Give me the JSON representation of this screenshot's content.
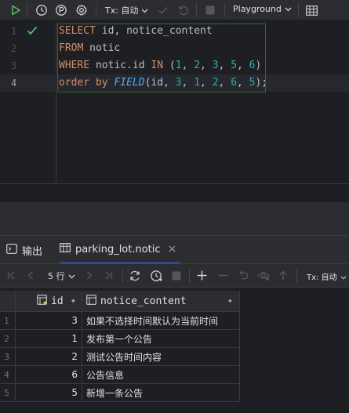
{
  "toolbar": {
    "tx_label": "Tx: 自动",
    "playground_label": "Playground",
    "accent_run": "#5fb865"
  },
  "editor": {
    "lines": [
      {
        "no": "1"
      },
      {
        "no": "2"
      },
      {
        "no": "3"
      },
      {
        "no": "4"
      }
    ],
    "line1": {
      "kw": "SELECT",
      "rest": " id, notice_content"
    },
    "line2": {
      "kw": "FROM",
      "rest": " notic"
    },
    "line3": {
      "kw1": "WHERE",
      "mid": " notic.id ",
      "kw2": "IN",
      "open": " (",
      "n1": "1",
      "c1": ", ",
      "n2": "2",
      "c2": ", ",
      "n3": "3",
      "c3": ", ",
      "n4": "5",
      "c4": ", ",
      "n5": "6",
      "close": ")"
    },
    "line4": {
      "kw": "order by",
      "sp": " ",
      "fn": "FIELD",
      "args1": "(id, ",
      "n1": "3",
      "c1": ", ",
      "n2": "1",
      "c2": ", ",
      "n3": "2",
      "c3": ", ",
      "n4": "6",
      "c4": ", ",
      "n5": "5",
      "close": ");"
    }
  },
  "tabs": {
    "output": "输出",
    "result": "parking_lot.notic"
  },
  "result_toolbar": {
    "rows_label": "5 行",
    "tx_label": "Tx: 自动"
  },
  "grid": {
    "columns": [
      "id",
      "notice_content"
    ],
    "rows": [
      {
        "no": "1",
        "id": "3",
        "content": "如果不选择时间默认为当前时间"
      },
      {
        "no": "2",
        "id": "1",
        "content": "发布第一个公告"
      },
      {
        "no": "3",
        "id": "2",
        "content": "测试公告时间内容"
      },
      {
        "no": "4",
        "id": "6",
        "content": "公告信息"
      },
      {
        "no": "5",
        "id": "5",
        "content": "新增一条公告"
      }
    ]
  }
}
